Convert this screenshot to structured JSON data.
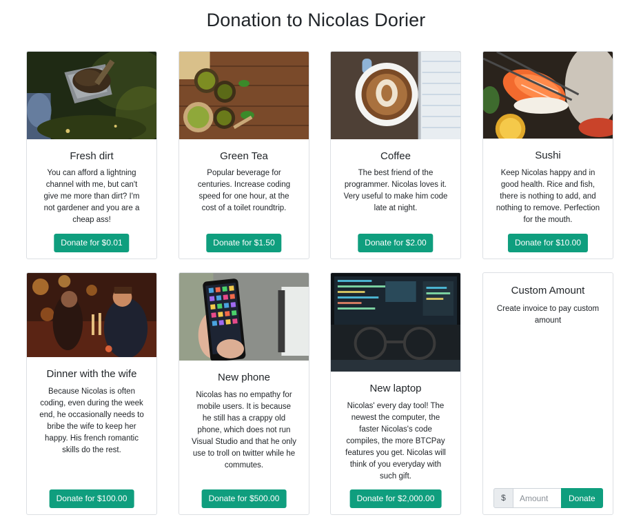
{
  "page": {
    "title": "Donation to Nicolas Dorier"
  },
  "items": [
    {
      "title": "Fresh dirt",
      "description": "You can afford a lightning channel with me, but can't give me more than dirt? I'm not gardener and you are a cheap ass!",
      "button": "Donate for $0.01",
      "image_icon": "shovel-dirt-photo"
    },
    {
      "title": "Green Tea",
      "description": "Popular beverage for centuries. Increase coding speed for one hour, at the cost of a toilet roundtrip.",
      "button": "Donate for $1.50",
      "image_icon": "green-tea-photo"
    },
    {
      "title": "Coffee",
      "description": "The best friend of the programmer. Nicolas loves it. Very useful to make him code late at night.",
      "button": "Donate for $2.00",
      "image_icon": "coffee-cup-photo"
    },
    {
      "title": "Sushi",
      "description": "Keep Nicolas happy and in good health. Rice and fish, there is nothing to add, and nothing to remove. Perfection for the mouth.",
      "button": "Donate for $10.00",
      "image_icon": "sushi-photo"
    },
    {
      "title": "Dinner with the wife",
      "description": "Because Nicolas is often coding, even during the week end, he occasionally needs to bribe the wife to keep her happy. His french romantic skills do the rest.",
      "button": "Donate for $100.00",
      "image_icon": "dinner-couple-photo"
    },
    {
      "title": "New phone",
      "description": "Nicolas has no empathy for mobile users. It is because he still has a crappy old phone, which does not run Visual Studio and that he only use to troll on twitter while he commutes.",
      "button": "Donate for $500.00",
      "image_icon": "smartphone-photo"
    },
    {
      "title": "New laptop",
      "description": "Nicolas' every day tool! The newest the computer, the faster Nicolas's code compiles, the more BTCPay features you get. Nicolas will think of you everyday with such gift.",
      "button": "Donate for $2,000.00",
      "image_icon": "laptop-code-photo"
    }
  ],
  "custom": {
    "title": "Custom Amount",
    "description": "Create invoice to pay custom amount",
    "currency_symbol": "$",
    "placeholder": "Amount",
    "button": "Donate"
  },
  "colors": {
    "accent": "#0f9e7e",
    "border": "#dcdfe3",
    "text": "#212529"
  }
}
